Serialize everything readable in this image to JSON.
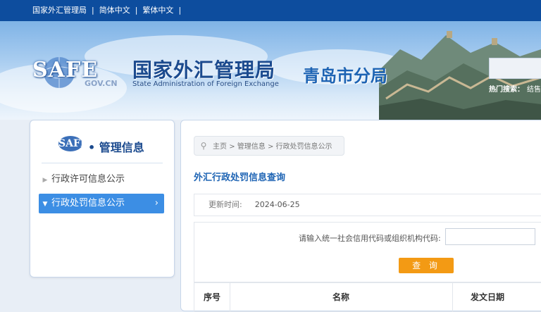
{
  "topbar": {
    "links": [
      "国家外汇管理局",
      "简体中文",
      "繁体中文"
    ],
    "separator": "|"
  },
  "banner": {
    "logo_text": "SAFE",
    "gov_cn": "GOV.CN",
    "bureau_name_cn": "国家外汇管理局",
    "bureau_name_en": "State Administration of Foreign Exchange",
    "branch_name": "青岛市分局",
    "hot_search_label": "热门搜索：",
    "hot_search_keyword": "结售"
  },
  "sidebar": {
    "logo_text": "SAFE",
    "title": "• 管理信息",
    "items": [
      {
        "label": "行政许可信息公示",
        "active": false
      },
      {
        "label": "行政处罚信息公示",
        "active": true
      }
    ]
  },
  "content": {
    "breadcrumb": [
      "主页",
      "管理信息",
      "行政处罚信息公示"
    ],
    "breadcrumb_sep": ">",
    "section_title": "外汇行政处罚信息查询",
    "update_label": "更新时间:",
    "update_value": "2024-06-25",
    "query_label": "请输入统一社会信用代码或组织机构代码:",
    "query_placeholder": "",
    "query_button": "查 询",
    "table_headers": [
      "序号",
      "名称",
      "发文日期"
    ]
  },
  "colors": {
    "topbar": "#0d4d9e",
    "accent": "#3c8ee4",
    "button": "#f39a14",
    "title_blue": "#1e64b4"
  }
}
